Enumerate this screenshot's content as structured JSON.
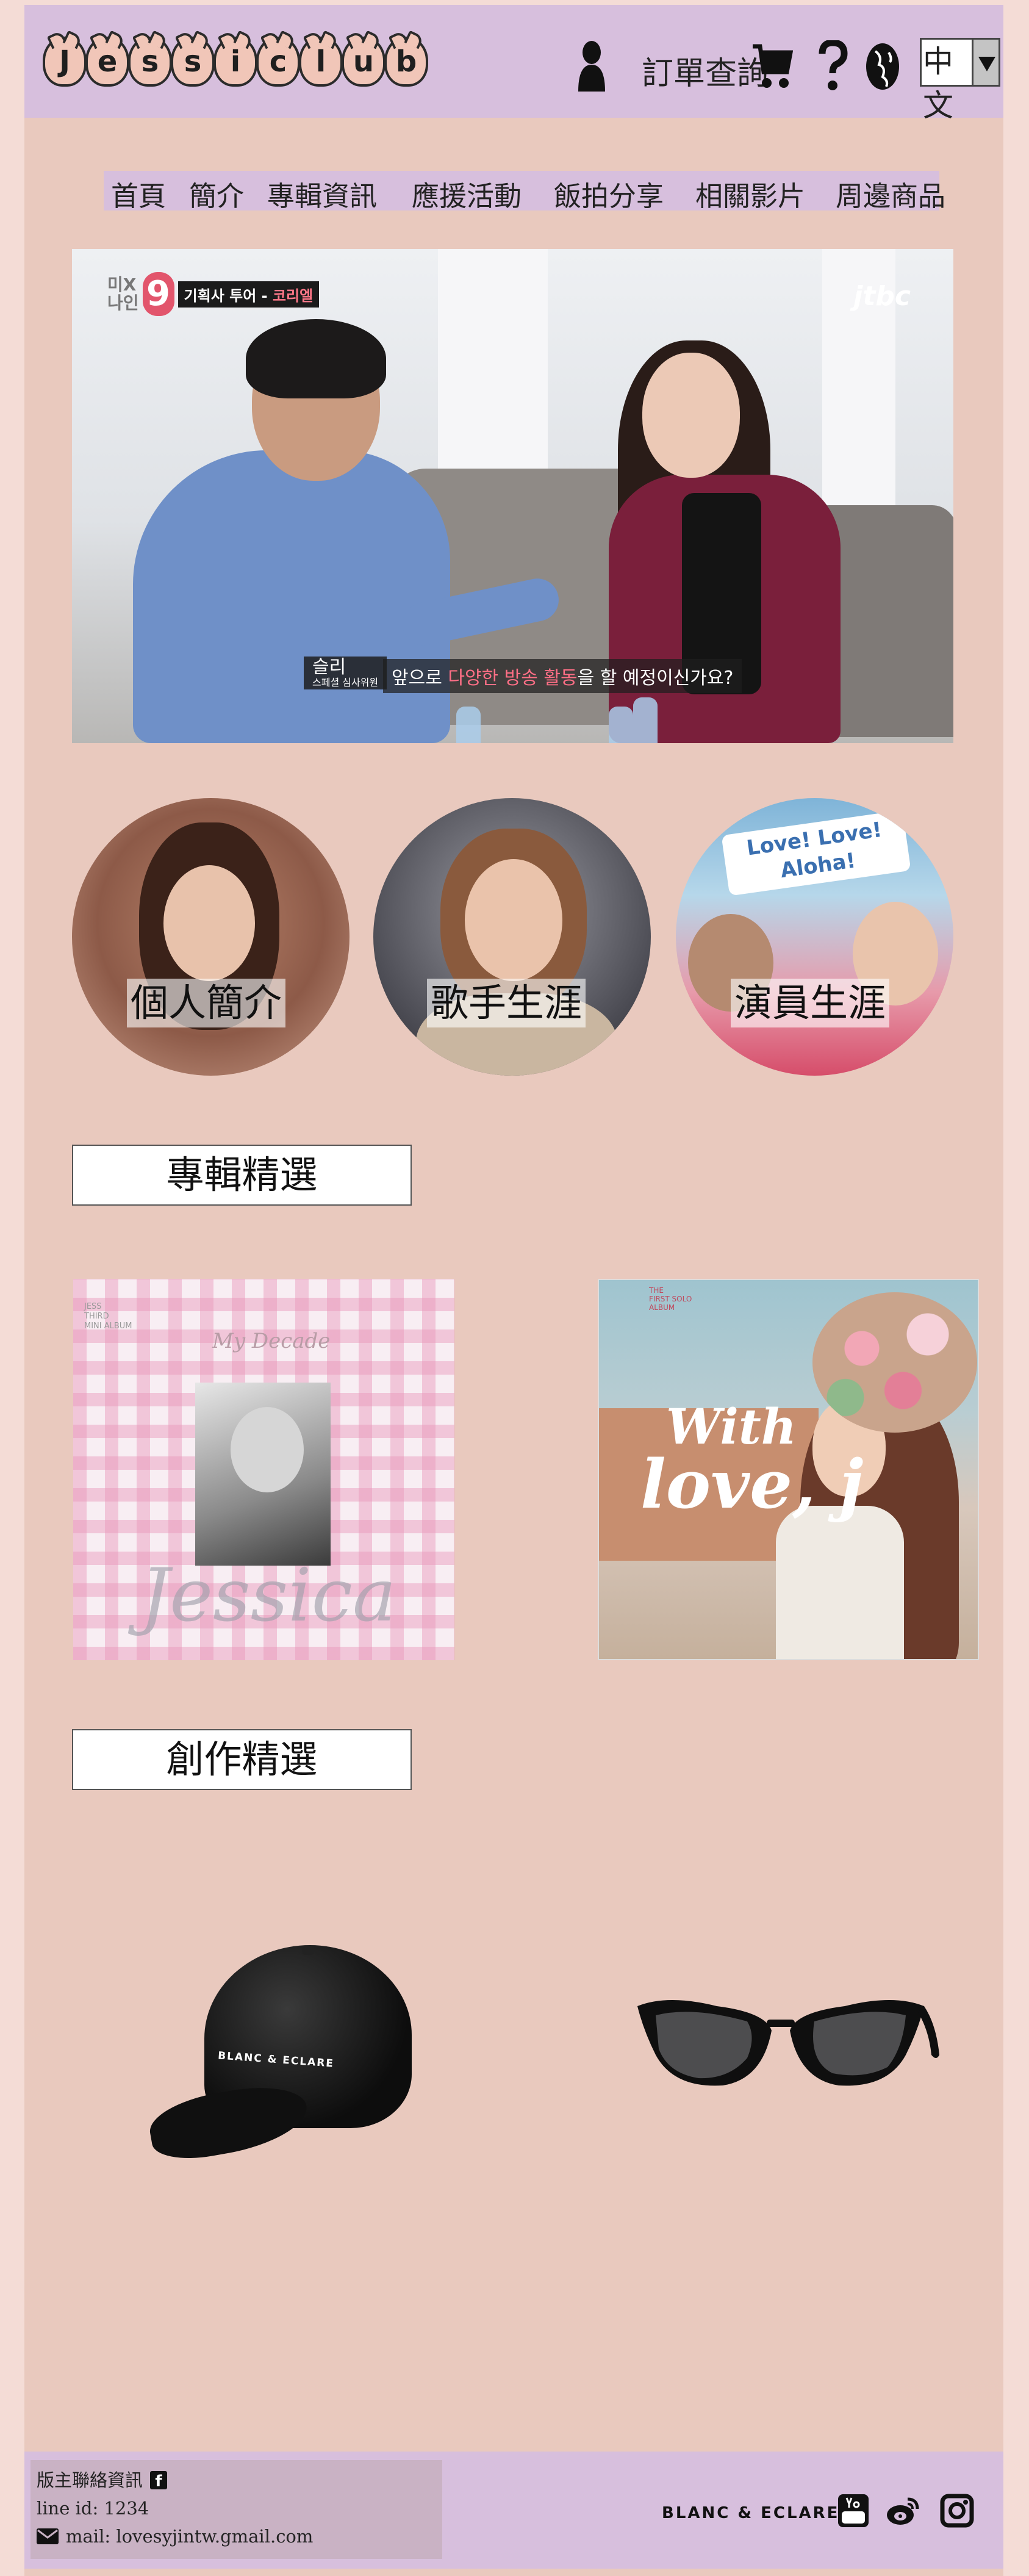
{
  "header": {
    "logo_letters": [
      "J",
      "e",
      "s",
      "s",
      "i",
      "c",
      "l",
      "u",
      "b"
    ],
    "order_lookup": "訂單查詢",
    "language": "中文"
  },
  "nav": {
    "items": [
      "首頁",
      "簡介",
      "專輯資訊",
      "應援活動",
      "飯拍分享",
      "相關影片",
      "周邊商品"
    ]
  },
  "hero": {
    "show_number": "9",
    "show_small": "미X\n나인",
    "show_tag_prefix": "기획사 투어 - ",
    "show_tag_highlight": "코리엘",
    "network": "jtbc",
    "caption_name": "슬리",
    "caption_role": "스페셜 심사위원",
    "caption_pre": "앞으로 ",
    "caption_highlight": "다양한 방송 활동",
    "caption_post": "을 할 예정이신가요?"
  },
  "features": [
    {
      "label": "個人簡介"
    },
    {
      "label": "歌手生涯"
    },
    {
      "label": "演員生涯"
    }
  ],
  "feature3_art": {
    "line1": "Love! Love!",
    "line2": "Aloha!"
  },
  "sections": {
    "albums_title": "專輯精選",
    "works_title": "創作精選"
  },
  "albums": [
    {
      "small": "JESS\nTHIRD\nMINI ALBUM",
      "subtitle": "My Decade",
      "script": "Jessica"
    },
    {
      "small": "THE\nFIRST SOLO\nALBUM",
      "title_line1": "With",
      "title_line2": "love, j"
    }
  ],
  "products": [
    {
      "name": "cap",
      "brand": "BLANC & ECLARE"
    },
    {
      "name": "sunglasses"
    }
  ],
  "footer": {
    "contact_label": "版主聯絡資訊",
    "line_id": "line id: 1234",
    "mail": "mail: lovesyjintw.gmail.com",
    "brand": "BLANC & ECLARE"
  },
  "colors": {
    "page_bg": "#e9c9be",
    "header_bg": "#d7bfdd",
    "outer_bg": "#f4dcd6"
  }
}
